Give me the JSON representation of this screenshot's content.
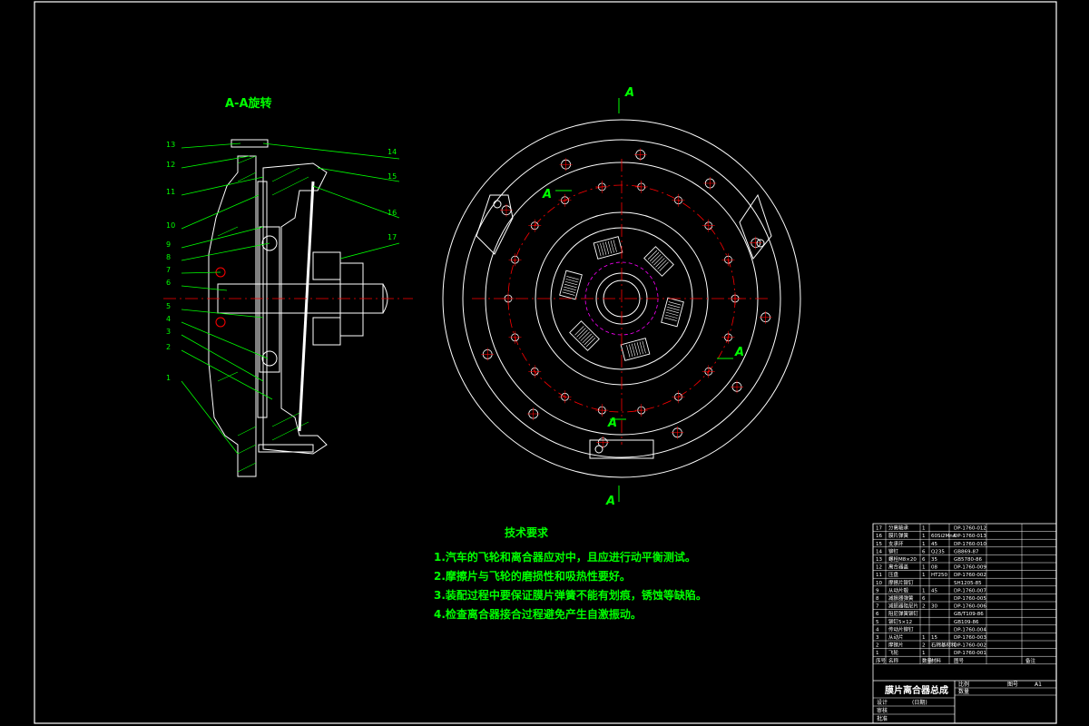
{
  "drawing": {
    "section_title": "A-A旋转",
    "section_letter": "A",
    "leader_numbers_left": [
      "13",
      "12",
      "11",
      "10",
      "9",
      "8",
      "7",
      "6",
      "5",
      "4",
      "3",
      "2",
      "1"
    ],
    "leader_numbers_right": [
      "14",
      "15",
      "16",
      "17"
    ]
  },
  "tech_requirements": {
    "title": "技术要求",
    "lines": [
      "1.汽车的飞轮和离合器应对中，且应进行动平衡测试。",
      "2.摩擦片与飞轮的磨损性和吸热性要好。",
      "3.装配过程中要保证膜片弹簧不能有划痕，锈蚀等缺陷。",
      "4.检查离合器接合过程避免产生自激振动。"
    ]
  },
  "bom": {
    "rows": [
      {
        "no": "17",
        "name": "分离轴承",
        "qty": "1",
        "mat": "",
        "code": "DP-1760-012"
      },
      {
        "no": "16",
        "name": "膜片弹簧",
        "qty": "1",
        "mat": "60Si2MnA",
        "code": "DP-1760-013"
      },
      {
        "no": "15",
        "name": "支承环",
        "qty": "1",
        "mat": "45",
        "code": "DP-1760-010"
      },
      {
        "no": "14",
        "name": "铆钉",
        "qty": "6",
        "mat": "Q235",
        "code": "GB869-87"
      },
      {
        "no": "13",
        "name": "螺栓M8×20",
        "qty": "6",
        "mat": "35",
        "code": "GB5780-86"
      },
      {
        "no": "12",
        "name": "离合器盖",
        "qty": "1",
        "mat": "08",
        "code": "DP-1760-009"
      },
      {
        "no": "11",
        "name": "压盘",
        "qty": "1",
        "mat": "HT250",
        "code": "DP-1760-002"
      },
      {
        "no": "10",
        "name": "摩擦片铆钉",
        "qty": "",
        "mat": "",
        "code": "SH1205-85"
      },
      {
        "no": "9",
        "name": "从动片毂",
        "qty": "1",
        "mat": "45",
        "code": "DP-1760-007"
      },
      {
        "no": "8",
        "name": "减振器弹簧",
        "qty": "6",
        "mat": "",
        "code": "DP-1760-005"
      },
      {
        "no": "7",
        "name": "减振器阻尼片",
        "qty": "2",
        "mat": "30",
        "code": "DP-1760-006"
      },
      {
        "no": "6",
        "name": "阻尼弹簧铆钉",
        "qty": "",
        "mat": "",
        "code": "GB/T109-86"
      },
      {
        "no": "5",
        "name": "铆钉5×12",
        "qty": "",
        "mat": "",
        "code": "GB109-86"
      },
      {
        "no": "4",
        "name": "传动片铆钉",
        "qty": "",
        "mat": "",
        "code": "DP-1760-004"
      },
      {
        "no": "3",
        "name": "从动片",
        "qty": "1",
        "mat": "15",
        "code": "DP-1760-003"
      },
      {
        "no": "2",
        "name": "摩擦片",
        "qty": "2",
        "mat": "石棉基材料",
        "code": "DP-1760-002"
      },
      {
        "no": "1",
        "name": "飞轮",
        "qty": "1",
        "mat": "",
        "code": "DP-1760-001"
      }
    ],
    "header": {
      "no": "序号",
      "name": "名称",
      "qty": "数量",
      "mat": "材料",
      "code": "图号",
      "note": "备注"
    },
    "assembly_title": "膜片离合器总成",
    "scale_label": "比例",
    "qty_label": "数量",
    "sheet_label": "图号",
    "sheet_value": "A1",
    "design_label": "设计",
    "check_label": "审核",
    "approve_label": "批准",
    "date_label": "(日期)"
  },
  "colors": {
    "background": "#000000",
    "lines": "#ffffff",
    "leaders": "#00ff00",
    "center": "#ff0000",
    "hatch": "#00ff00",
    "title": "#ffffff",
    "accent": "#ff00ff"
  }
}
